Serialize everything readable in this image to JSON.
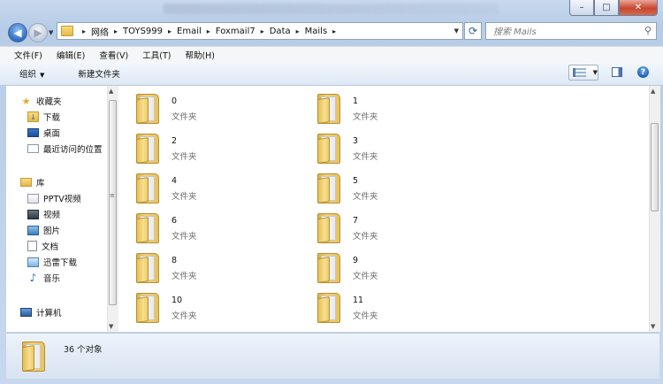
{
  "title_buttons": {
    "minimize": "–",
    "maximize": "□",
    "close": "✕"
  },
  "nav": {
    "breadcrumb": [
      "网络",
      "TOYS999",
      "Email",
      "Foxmail7",
      "Data",
      "Mails"
    ],
    "search_placeholder": "搜索 Mails"
  },
  "menubar": [
    "文件(F)",
    "编辑(E)",
    "查看(V)",
    "工具(T)",
    "帮助(H)"
  ],
  "commandbar": {
    "organize": "组织",
    "new_folder": "新建文件夹"
  },
  "sidebar": {
    "favorites": {
      "label": "收藏夹",
      "items": [
        "下载",
        "桌面",
        "最近访问的位置"
      ]
    },
    "libraries": {
      "label": "库",
      "items": [
        "PPTV视频",
        "视频",
        "图片",
        "文档",
        "迅雷下载",
        "音乐"
      ]
    },
    "computer": {
      "label": "计算机"
    }
  },
  "items": [
    {
      "name": "0",
      "type": "文件夹"
    },
    {
      "name": "1",
      "type": "文件夹"
    },
    {
      "name": "2",
      "type": "文件夹"
    },
    {
      "name": "3",
      "type": "文件夹"
    },
    {
      "name": "4",
      "type": "文件夹"
    },
    {
      "name": "5",
      "type": "文件夹"
    },
    {
      "name": "6",
      "type": "文件夹"
    },
    {
      "name": "7",
      "type": "文件夹"
    },
    {
      "name": "8",
      "type": "文件夹"
    },
    {
      "name": "9",
      "type": "文件夹"
    },
    {
      "name": "10",
      "type": "文件夹"
    },
    {
      "name": "11",
      "type": "文件夹"
    }
  ],
  "status": {
    "count": "36 个对象"
  }
}
